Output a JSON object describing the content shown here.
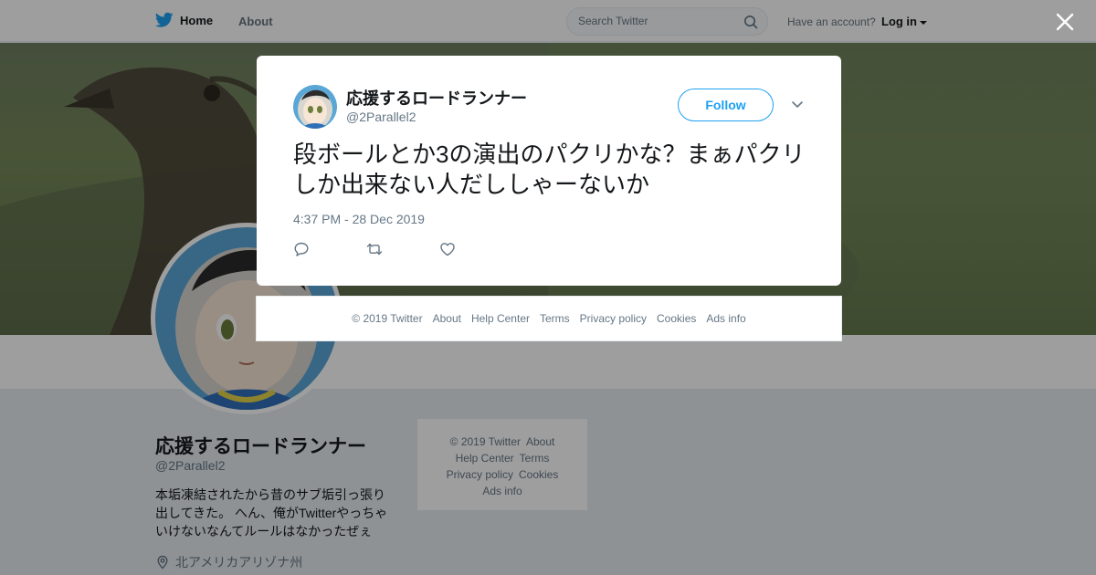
{
  "nav": {
    "home_label": "Home",
    "about_label": "About",
    "search_placeholder": "Search Twitter",
    "have_account": "Have an account?",
    "login_label": "Log in"
  },
  "profile": {
    "name": "応援するロードランナー",
    "handle": "@2Parallel2",
    "bio": "本垢凍結されたから昔のサブ垢引っ張り出してきた。 へん、俺がTwitterやっちゃいけないなんてルールはなかったぜぇ",
    "location": "北アメリカアリゾナ州"
  },
  "side_footer": {
    "copyright": "© 2019 Twitter",
    "about": "About",
    "help": "Help Center",
    "terms": "Terms",
    "privacy": "Privacy policy",
    "cookies": "Cookies",
    "ads": "Ads info"
  },
  "tweet": {
    "name": "応援するロードランナー",
    "handle": "@2Parallel2",
    "follow_label": "Follow",
    "text": "段ボールとか3の演出のパクリかな？まぁパクリしか出来ない人だししゃーないか",
    "timestamp": "4:37 PM - 28 Dec 2019",
    "actions": [
      "reply",
      "retweet",
      "like"
    ]
  },
  "modal_footer": {
    "copyright": "© 2019 Twitter",
    "about": "About",
    "help": "Help Center",
    "terms": "Terms",
    "privacy": "Privacy policy",
    "cookies": "Cookies",
    "ads": "Ads info"
  },
  "colors": {
    "accent": "#1da1f2",
    "text": "#14171a",
    "secondary": "#657786"
  },
  "icons": {
    "logo": "twitter-bird-icon",
    "search": "search-icon",
    "close": "close-icon",
    "caret": "chevron-down-icon",
    "reply": "reply-icon",
    "retweet": "retweet-icon",
    "like": "heart-icon",
    "location": "location-pin-icon"
  }
}
